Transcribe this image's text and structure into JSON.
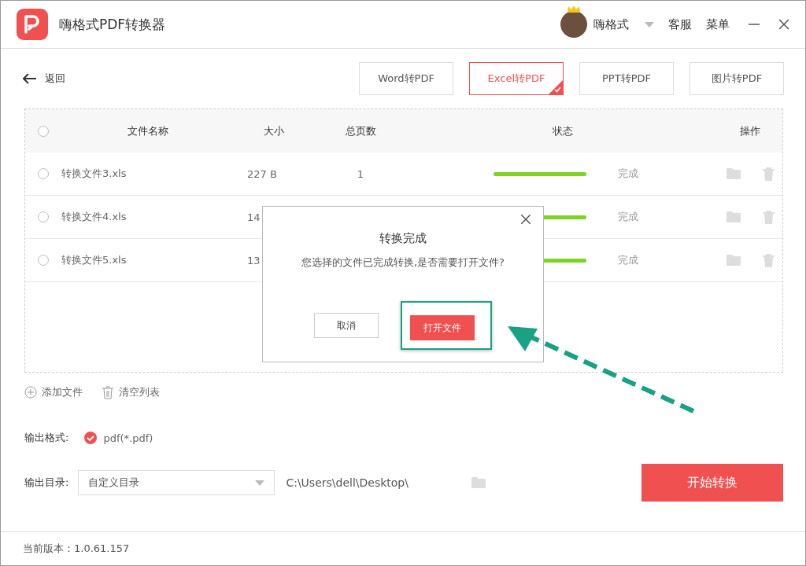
{
  "window": {
    "title": "嗨格式PDF转换器",
    "user": "嗨格式",
    "links": [
      "客服",
      "菜单"
    ]
  },
  "back": "返回",
  "tabs": [
    {
      "label": "Word转PDF",
      "selected": false
    },
    {
      "label": "Excel转PDF",
      "selected": true
    },
    {
      "label": "PPT转PDF",
      "selected": false
    },
    {
      "label": "图片转PDF",
      "selected": false
    }
  ],
  "table": {
    "columns": [
      "文件名称",
      "大小",
      "总页数",
      "状态",
      "操作"
    ],
    "all_checked": false,
    "rows": [
      {
        "checked": false,
        "name": "转换文件3.xls",
        "size": "227 B",
        "pages": "1",
        "level": 1,
        "status": "完成"
      },
      {
        "checked": false,
        "name": "转换文件4.xls",
        "size": "14",
        "level": 1,
        "status": "完成"
      },
      {
        "checked": false,
        "name": "转换文件5.xls",
        "size": "13",
        "level": 1,
        "status": "完成"
      }
    ]
  },
  "actions": [
    "添加文件",
    "清空列表"
  ],
  "output_format": {
    "label": "输出格式:",
    "value": "pdf(*.pdf)"
  },
  "output_dir": {
    "label": "输出目录:",
    "select": "自定义目录",
    "path": "C:\\Users\\dell\\Desktop\\"
  },
  "start_button": "开始转换",
  "version": "当前版本：1.0.61.157",
  "dialog": {
    "title": "转换完成",
    "message": "您选择的文件已完成转换,是否需要打开文件?",
    "buttons": [
      "取消",
      "打开文件"
    ]
  }
}
